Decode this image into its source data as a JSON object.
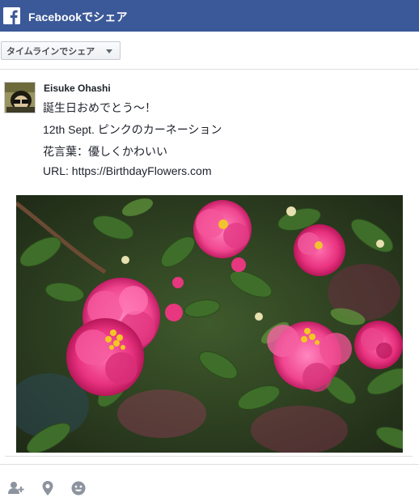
{
  "header": {
    "title": "Facebookでシェア",
    "logo_icon": "facebook-f-icon",
    "background": "#3b5998"
  },
  "share_target": {
    "selected": "タイムラインでシェア"
  },
  "post": {
    "author": "Eisuke Ohashi",
    "lines": [
      "誕生日おめでとう～！",
      "12th Sept. ピンクのカーネーション",
      "花言葉：優しくかわいい",
      "URL: https://BirthdayFlowers.com"
    ],
    "image": "pink camellia flowers among dark green leaves"
  },
  "toolbar": {
    "icons": [
      "tag-friends-icon",
      "location-pin-icon",
      "feeling-emoji-icon"
    ]
  }
}
